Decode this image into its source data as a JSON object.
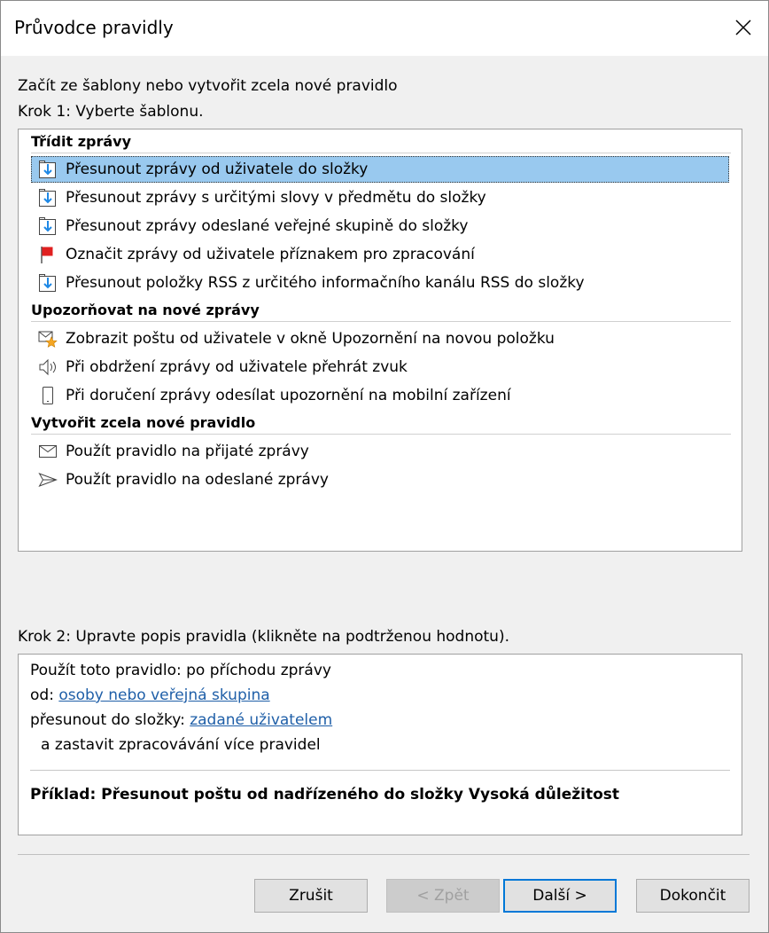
{
  "window": {
    "title": "Průvodce pravidly"
  },
  "intro": {
    "line1": "Začít ze šablony nebo vytvořit zcela nové pravidlo",
    "line2": "Krok 1: Vyberte šablonu."
  },
  "groups": [
    {
      "header": "Třídit zprávy"
    },
    {
      "header": "Upozorňovat na nové zprávy"
    },
    {
      "header": "Vytvořit zcela nové pravidlo"
    }
  ],
  "templates": [
    {
      "label": "Přesunout zprávy od uživatele do složky",
      "icon": "move-to-folder-icon"
    },
    {
      "label": "Přesunout zprávy s určitými slovy v předmětu do složky",
      "icon": "move-to-folder-icon"
    },
    {
      "label": "Přesunout zprávy odeslané veřejné skupině do složky",
      "icon": "move-to-folder-icon"
    },
    {
      "label": "Označit zprávy od uživatele příznakem pro zpracování",
      "icon": "red-flag-icon"
    },
    {
      "label": "Přesunout položky RSS z určitého informačního kanálu RSS do složky",
      "icon": "move-to-folder-icon"
    },
    {
      "label": "Zobrazit poštu od uživatele v okně Upozornění na novou položku",
      "icon": "mail-star-icon"
    },
    {
      "label": "Při obdržení zprávy od uživatele přehrát zvuk",
      "icon": "speaker-icon"
    },
    {
      "label": "Při doručení zprávy odesílat upozornění na mobilní zařízení",
      "icon": "mobile-phone-icon"
    },
    {
      "label": "Použít pravidlo na přijaté zprávy",
      "icon": "envelope-icon"
    },
    {
      "label": "Použít pravidlo na odeslané zprávy",
      "icon": "send-arrow-icon"
    }
  ],
  "step2": {
    "label": "Krok 2: Upravte popis pravidla (klikněte na podtrženou hodnotu).",
    "line1": "Použít toto pravidlo: po příchodu zprávy",
    "line2_prefix": "od: ",
    "line2_link": "osoby nebo veřejná skupina",
    "line3_prefix": "přesunout do složky: ",
    "line3_link": "zadané uživatelem",
    "line4": "a zastavit zpracovávání více pravidel",
    "example": "Příklad: Přesunout poštu od nadřízeného do složky Vysoká důležitost"
  },
  "buttons": {
    "cancel": "Zrušit",
    "back": "< Zpět",
    "next": "Další >",
    "finish": "Dokončit"
  },
  "colors": {
    "selection": "#99c9ef",
    "link": "#1f5fa8",
    "accent": "#0078d7",
    "flag": "#e02020",
    "folder_arrow": "#1e88e5",
    "star": "#f5a623"
  }
}
